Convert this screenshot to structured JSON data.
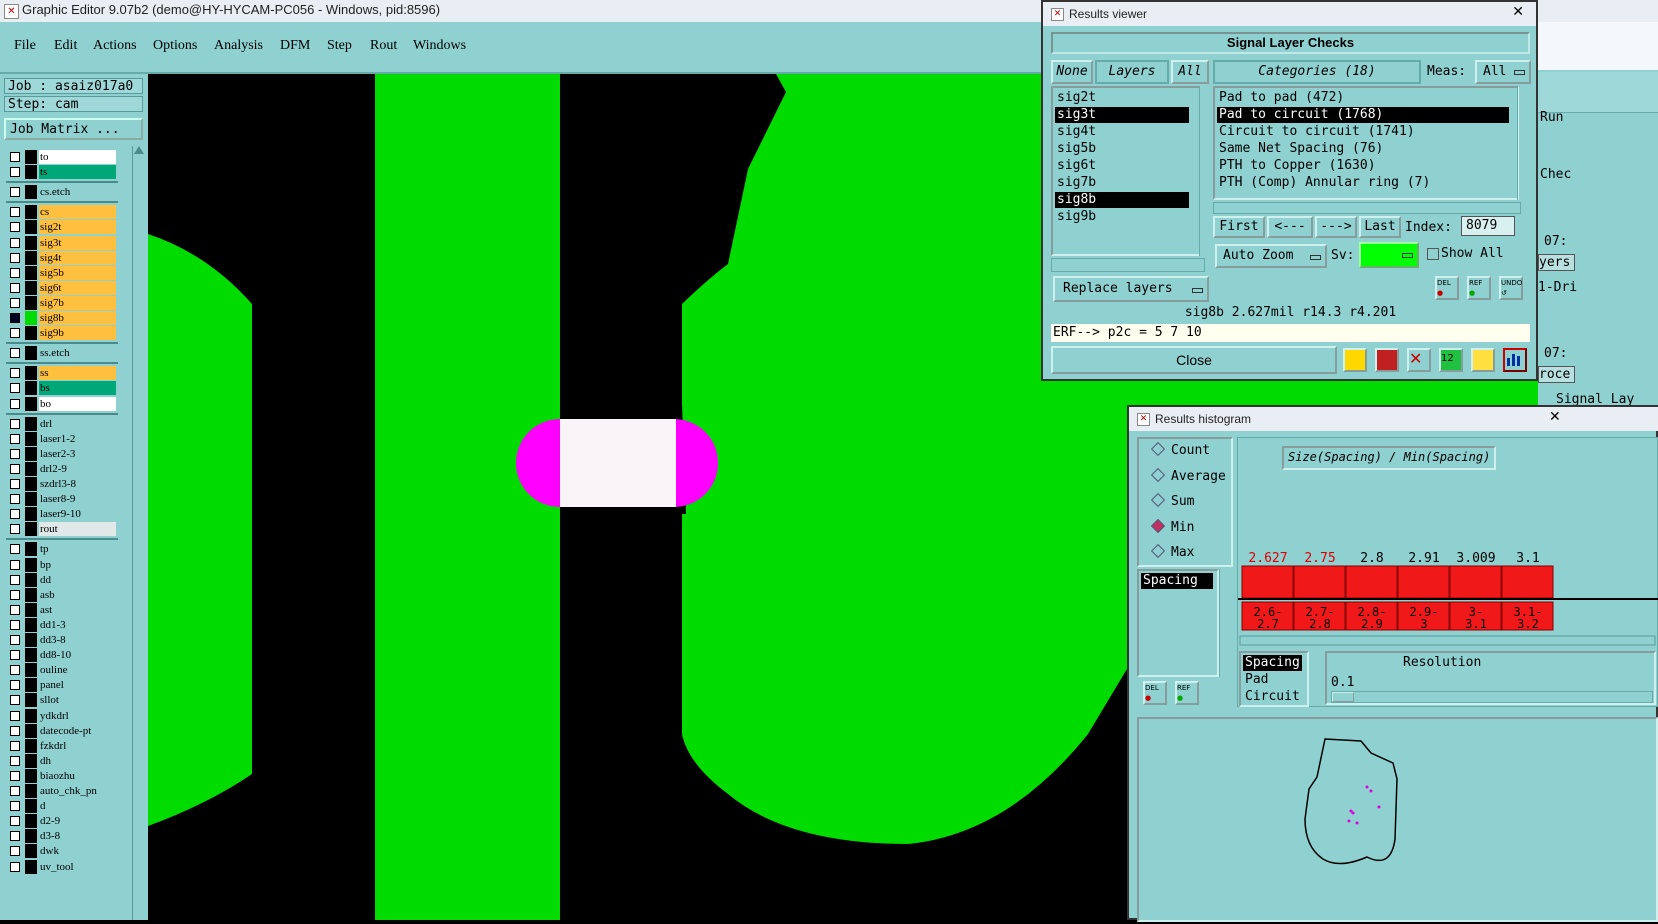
{
  "window": {
    "title": "Graphic Editor 9.07b2 (demo@HY-HYCAM-PC056 - Windows, pid:8596)"
  },
  "menu": [
    "File",
    "Edit",
    "Actions",
    "Options",
    "Analysis",
    "DFM",
    "Step",
    "Rout",
    "Windows"
  ],
  "left": {
    "job": "Job : asaiz017a0",
    "step": "Step: cam",
    "job_matrix": "Job Matrix ...",
    "layers": [
      {
        "name": "to",
        "color": "#ffffff",
        "group": 1
      },
      {
        "name": "ts",
        "color": "#00a878",
        "group": 1
      },
      {
        "name": "cs.etch",
        "color": "#8fd0d0",
        "group": 2
      },
      {
        "name": "cs",
        "color": "#ffc040",
        "group": 3
      },
      {
        "name": "sig2t",
        "color": "#ffc040",
        "group": 3
      },
      {
        "name": "sig3t",
        "color": "#ffc040",
        "group": 3
      },
      {
        "name": "sig4t",
        "color": "#ffc040",
        "group": 3
      },
      {
        "name": "sig5b",
        "color": "#ffc040",
        "group": 3
      },
      {
        "name": "sig6t",
        "color": "#ffc040",
        "group": 3
      },
      {
        "name": "sig7b",
        "color": "#ffc040",
        "group": 3
      },
      {
        "name": "sig8b",
        "color": "#ffc040",
        "group": 3,
        "active": true
      },
      {
        "name": "sig9b",
        "color": "#ffc040",
        "group": 3
      },
      {
        "name": "ss.etch",
        "color": "#8fd0d0",
        "group": 4
      },
      {
        "name": "ss",
        "color": "#ffc040",
        "group": 5
      },
      {
        "name": "bs",
        "color": "#00a878",
        "group": 5
      },
      {
        "name": "bo",
        "color": "#ffffff",
        "group": 5
      },
      {
        "name": "drl",
        "color": "#8fd0d0",
        "group": 6
      },
      {
        "name": "laser1-2",
        "color": "#8fd0d0",
        "group": 6
      },
      {
        "name": "laser2-3",
        "color": "#8fd0d0",
        "group": 6
      },
      {
        "name": "drl2-9",
        "color": "#8fd0d0",
        "group": 6
      },
      {
        "name": "szdrl3-8",
        "color": "#8fd0d0",
        "group": 6
      },
      {
        "name": "laser8-9",
        "color": "#8fd0d0",
        "group": 6
      },
      {
        "name": "laser9-10",
        "color": "#8fd0d0",
        "group": 6
      },
      {
        "name": "rout",
        "color": "#e0e8e8",
        "group": 6
      },
      {
        "name": "tp",
        "color": "#8fd0d0",
        "group": 7
      },
      {
        "name": "bp",
        "color": "#8fd0d0",
        "group": 7
      },
      {
        "name": "dd",
        "color": "#8fd0d0",
        "group": 7
      },
      {
        "name": "asb",
        "color": "#8fd0d0",
        "group": 7
      },
      {
        "name": "ast",
        "color": "#8fd0d0",
        "group": 7
      },
      {
        "name": "dd1-3",
        "color": "#8fd0d0",
        "group": 7
      },
      {
        "name": "dd3-8",
        "color": "#8fd0d0",
        "group": 7
      },
      {
        "name": "dd8-10",
        "color": "#8fd0d0",
        "group": 7
      },
      {
        "name": "ouline",
        "color": "#8fd0d0",
        "group": 7
      },
      {
        "name": "panel",
        "color": "#8fd0d0",
        "group": 7
      },
      {
        "name": "sllot",
        "color": "#8fd0d0",
        "group": 7
      },
      {
        "name": "ydkdrl",
        "color": "#8fd0d0",
        "group": 7
      },
      {
        "name": "datecode-pt",
        "color": "#8fd0d0",
        "group": 7
      },
      {
        "name": "fzkdrl",
        "color": "#8fd0d0",
        "group": 7
      },
      {
        "name": "dh",
        "color": "#8fd0d0",
        "group": 7
      },
      {
        "name": "biaozhu",
        "color": "#8fd0d0",
        "group": 7
      },
      {
        "name": "auto_chk_pn",
        "color": "#8fd0d0",
        "group": 7
      },
      {
        "name": "d",
        "color": "#8fd0d0",
        "group": 7
      },
      {
        "name": "d2-9",
        "color": "#8fd0d0",
        "group": 7
      },
      {
        "name": "d3-8",
        "color": "#8fd0d0",
        "group": 7
      },
      {
        "name": "dwk",
        "color": "#8fd0d0",
        "group": 7
      },
      {
        "name": "uv_tool",
        "color": "#8fd0d0",
        "group": 7
      }
    ]
  },
  "colors": {
    "copper": "#00dc00",
    "violation_pad": "#ff00ff",
    "violation_line": "#f8f4f8",
    "panel": "#8fd0d0"
  },
  "results_viewer": {
    "title": "Results viewer",
    "header": "Signal Layer Checks",
    "none_btn": "None",
    "layers_label": "Layers",
    "all_btn": "All",
    "categories_label": "Categories (18)",
    "meas_label": "Meas:",
    "meas_value": "All",
    "layers": [
      "sig2t",
      "sig3t",
      "sig4t",
      "sig5b",
      "sig6t",
      "sig7b",
      "sig8b",
      "sig9b"
    ],
    "selected_layers": [
      "sig3t",
      "sig8b"
    ],
    "categories": [
      "Pad to pad (472)",
      "Pad to circuit (1768)",
      "Circuit to circuit (1741)",
      "Same Net Spacing (76)",
      "PTH to Copper (1630)",
      "PTH (Comp) Annular ring (7)"
    ],
    "selected_category": "Pad to circuit (1768)",
    "first": "First",
    "prev": "<---",
    "next": "--->",
    "last": "Last",
    "index_label": "Index:",
    "index_value": "8079",
    "auto_zoom": "Auto Zoom",
    "sv_label": "Sv:",
    "show_all": "Show All",
    "replace_layers": "Replace layers",
    "status": "sig8b 2.627mil  r14.3  r4.201",
    "erf": "ERF--> p2c = 5 7 10",
    "close": "Close"
  },
  "histogram": {
    "title": "Results histogram",
    "radios": [
      "Count",
      "Average",
      "Sum",
      "Min",
      "Max"
    ],
    "selected_radio": "Min",
    "measure_list": [
      "Spacing"
    ],
    "chart_title": "Size(Spacing) / Min(Spacing)",
    "resolution_label": "Resolution",
    "resolution_value": "0.1",
    "size_list": [
      "Spacing",
      "Pad",
      "Circuit"
    ],
    "chart_data": {
      "type": "bar",
      "title": "Size(Spacing) / Min(Spacing)",
      "categories": [
        "2.6-2.7",
        "2.7-2.8",
        "2.8-2.9",
        "2.9-3",
        "3-3.1",
        "3.1-3.2"
      ],
      "values": [
        2.627,
        2.75,
        2.8,
        2.91,
        3.009,
        3.1
      ],
      "labels": [
        "2.627",
        "2.75",
        "2.8",
        "2.91",
        "3.009",
        "3.1"
      ],
      "bar_color": "#f01818",
      "highlight_color": "#e00000"
    }
  },
  "right_partial": {
    "run": "Run",
    "chec": "Chec",
    "time1": "07:",
    "yers": "yers",
    "dri": "1-Dri",
    "time2": "07:",
    "roce": "roce",
    "signal": "Signal Lay"
  }
}
